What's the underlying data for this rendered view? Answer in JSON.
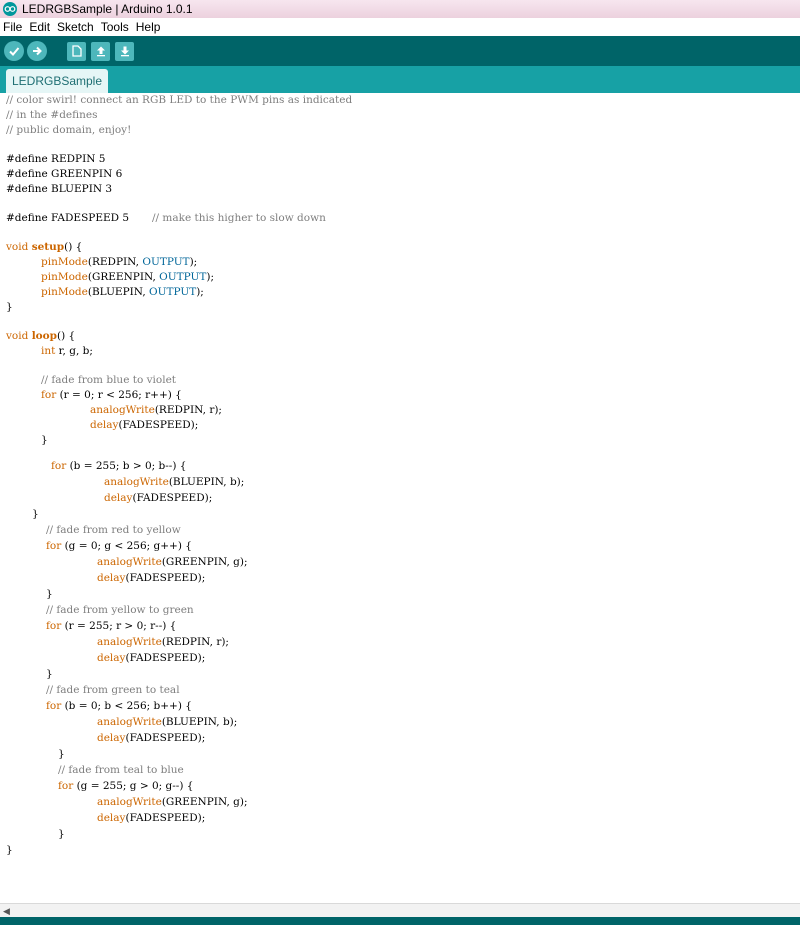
{
  "window": {
    "title": "LEDRGBSample | Arduino 1.0.1"
  },
  "menu": [
    "File",
    "Edit",
    "Sketch",
    "Tools",
    "Help"
  ],
  "toolbar": {
    "buttons": [
      "verify-icon",
      "upload-icon",
      "new-icon",
      "open-icon",
      "save-icon"
    ]
  },
  "tabs": [
    {
      "label": "LEDRGBSample"
    }
  ],
  "colors": {
    "toolbar": "#006468",
    "tabbar": "#17a1a5",
    "keyword": "#cc6600",
    "comment": "#7e7e7e",
    "constant": "#006699"
  },
  "code": {
    "l1": "// color swirl! connect an RGB LED to the PWM pins as indicated",
    "l2": "// in the #defines",
    "l3": "// public domain, enjoy!",
    "d1": "#define REDPIN 5",
    "d2": "#define GREENPIN 6",
    "d3": "#define BLUEPIN 3",
    "d4": "#define FADESPEED 5",
    "d4c": "// make this higher to slow down",
    "void": "void",
    "setup": "setup",
    "loop": "loop",
    "paren_open": "() {",
    "pinMode": "pinMode",
    "p1": "(REDPIN, ",
    "p2": "(GREENPIN, ",
    "p3": "(BLUEPIN, ",
    "output": "OUTPUT",
    "close_paren": ");",
    "brace": "}",
    "int": "int",
    "vars": " r, g, b;",
    "c1": "// fade from blue to violet",
    "c2": "// fade from red to yellow",
    "c3": "// fade from yellow to green",
    "c4": "// fade from green to teal",
    "c5": "// fade from teal to blue",
    "for": "for",
    "f1": " (r = 0; r < 256; r++) {",
    "f2": " (b = 255; b > 0; b--) {",
    "f3": " (g = 0; g < 256; g++) {",
    "f4": " (r = 255; r > 0; r--) {",
    "f5": " (b = 0; b < 256; b++) {",
    "f6": " (g = 255; g > 0; g--) {",
    "analogWrite": "analogWrite",
    "a_red": "(REDPIN, r);",
    "a_blue": "(BLUEPIN, b);",
    "a_green": "(GREENPIN, g);",
    "delay": "delay",
    "delay_args": "(FADESPEED);"
  }
}
